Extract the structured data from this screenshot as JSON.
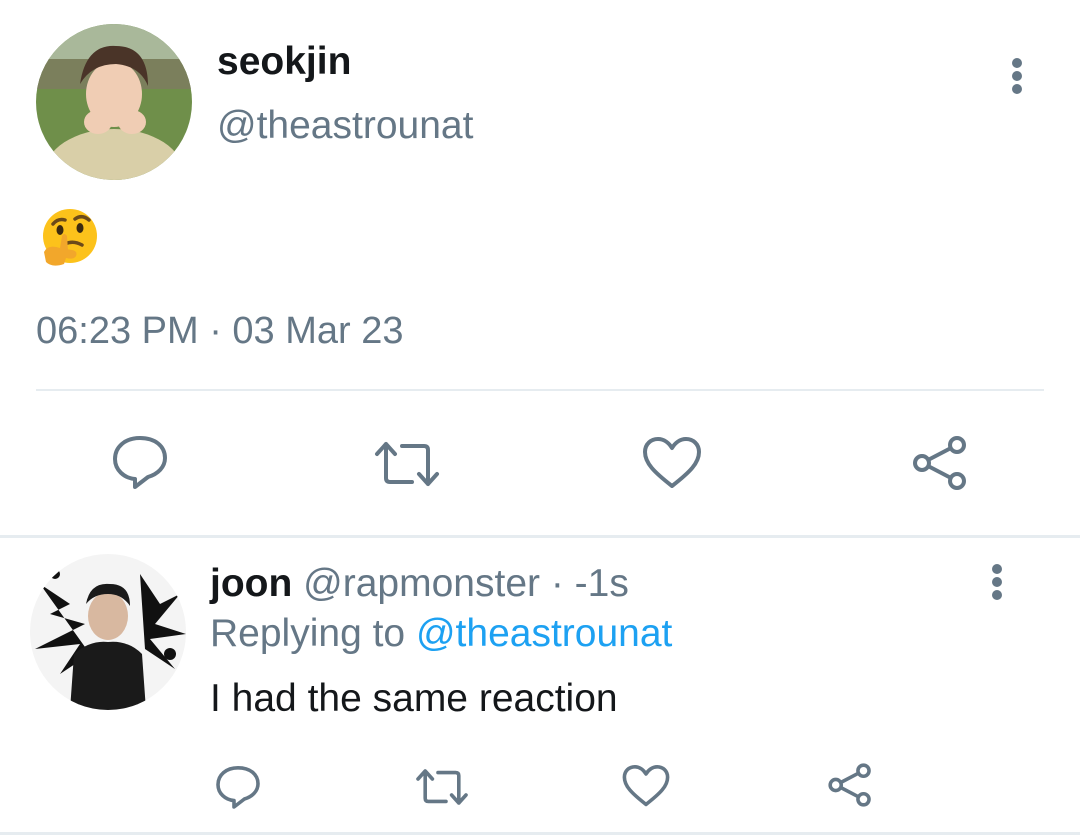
{
  "tweet": {
    "author_name": "seokjin",
    "author_handle": "@theastrounat",
    "body_emoji": "thinking-face-emoji",
    "timestamp": "06:23 PM · 03 Mar 23"
  },
  "reply": {
    "author_name": "joon",
    "author_handle": "@rapmonster",
    "separator": " · ",
    "age": "-1s",
    "replying_label": "Replying to ",
    "replying_handle": "@theastrounat",
    "text": "I had the same reaction"
  },
  "icons": {
    "reply": "comment-icon",
    "retweet": "retweet-icon",
    "like": "heart-icon",
    "share": "share-icon",
    "more": "more-vertical-icon"
  },
  "colors": {
    "primary_text": "#14171a",
    "secondary_text": "#657786",
    "link": "#1da1f2",
    "divider": "#e6ecf0"
  }
}
